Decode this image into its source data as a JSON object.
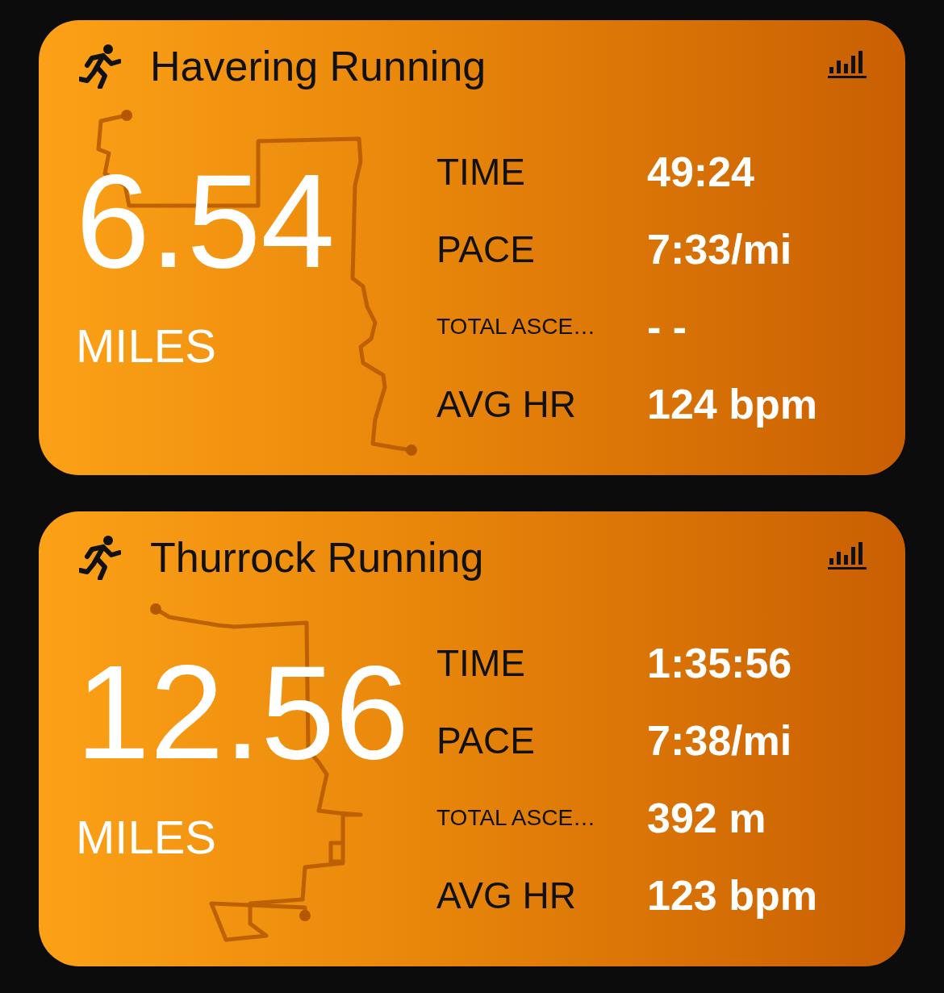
{
  "cards": [
    {
      "title": "Havering Running",
      "distance": "6.54",
      "unit": "MILES",
      "stats": [
        {
          "label": "TIME",
          "value": "49:24",
          "kind": "normal"
        },
        {
          "label": "PACE",
          "value": "7:33/mi",
          "kind": "normal"
        },
        {
          "label": "TOTAL ASCE…",
          "value": "- -",
          "kind": "small"
        },
        {
          "label": "AVG HR",
          "value": "124 bpm",
          "kind": "normal"
        }
      ]
    },
    {
      "title": "Thurrock Running",
      "distance": "12.56",
      "unit": "MILES",
      "stats": [
        {
          "label": "TIME",
          "value": "1:35:56",
          "kind": "normal"
        },
        {
          "label": "PACE",
          "value": "7:38/mi",
          "kind": "normal"
        },
        {
          "label": "TOTAL ASCE…",
          "value": "392 m",
          "kind": "small"
        },
        {
          "label": "AVG HR",
          "value": "123 bpm",
          "kind": "normal"
        }
      ]
    }
  ]
}
